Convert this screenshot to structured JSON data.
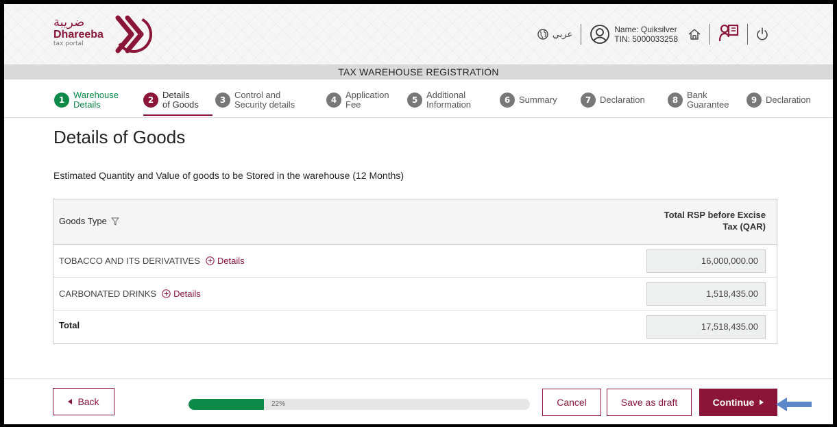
{
  "brand": {
    "logo_ar": "ضريبة",
    "logo_en": "Dhareeba",
    "logo_sub": "tax portal",
    "color": "#8a1538"
  },
  "header": {
    "language_label": "عربي",
    "user_name": "Name: Quiksilver",
    "user_tin": "TIN: 5000033258"
  },
  "page_band_title": "TAX WAREHOUSE REGISTRATION",
  "steps": [
    {
      "num": "1",
      "label_1": "Warehouse",
      "label_2": "Details",
      "state": "done"
    },
    {
      "num": "2",
      "label_1": "Details",
      "label_2": "of Goods",
      "state": "active"
    },
    {
      "num": "3",
      "label_1": "Control and",
      "label_2": "Security details",
      "state": "pending"
    },
    {
      "num": "4",
      "label_1": "Application",
      "label_2": "Fee",
      "state": "pending"
    },
    {
      "num": "5",
      "label_1": "Additional",
      "label_2": "Information",
      "state": "pending"
    },
    {
      "num": "6",
      "label_1": "Summary",
      "label_2": "",
      "state": "pending"
    },
    {
      "num": "7",
      "label_1": "Declaration",
      "label_2": "",
      "state": "pending"
    },
    {
      "num": "8",
      "label_1": "Bank",
      "label_2": "Guarantee",
      "state": "pending"
    },
    {
      "num": "9",
      "label_1": "Declaration",
      "label_2": "",
      "state": "pending"
    }
  ],
  "main": {
    "title": "Details of Goods",
    "subtitle": "Estimated Quantity and Value of goods to be Stored in the warehouse (12 Months)"
  },
  "table": {
    "col_goods": "Goods Type",
    "col_rsp_1": "Total RSP before Excise",
    "col_rsp_2": "Tax (QAR)",
    "rows": [
      {
        "name": "TOBACCO AND ITS DERIVATIVES",
        "link": "Details",
        "value": "16,000,000.00"
      },
      {
        "name": "CARBONATED DRINKS",
        "link": "Details",
        "value": "1,518,435.00"
      }
    ],
    "total_label": "Total",
    "total_value": "17,518,435.00"
  },
  "footer": {
    "back": "Back",
    "progress_percent": 22,
    "progress_label": "22%",
    "cancel": "Cancel",
    "save_draft": "Save as draft",
    "continue": "Continue"
  }
}
